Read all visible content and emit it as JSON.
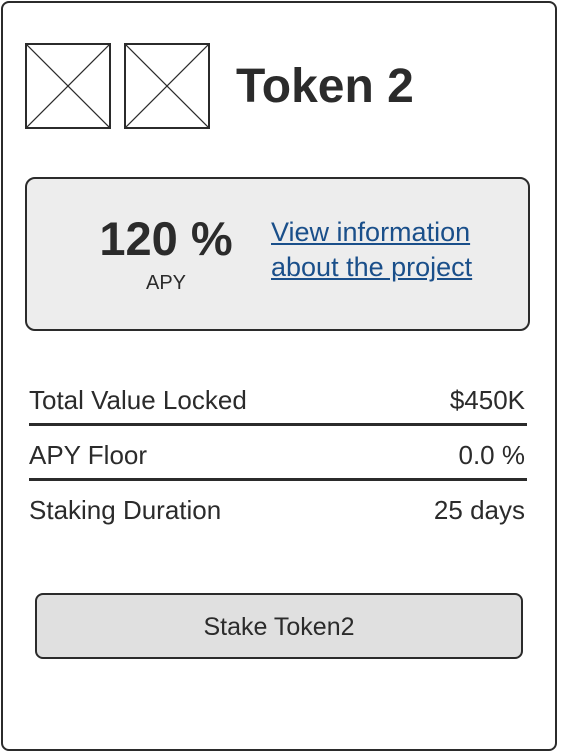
{
  "header": {
    "title": "Token 2",
    "icons": [
      "image-placeholder-icon",
      "image-placeholder-icon"
    ]
  },
  "apy_panel": {
    "value": "120 %",
    "label": "APY",
    "link_text": "View information about the project"
  },
  "stats": [
    {
      "label": "Total Value Locked",
      "value": "$450K"
    },
    {
      "label": "APY Floor",
      "value": "0.0 %"
    },
    {
      "label": "Staking Duration",
      "value": "25 days"
    }
  ],
  "actions": {
    "stake_label": "Stake Token2"
  },
  "colors": {
    "border": "#2b2b2b",
    "panel_background": "#ededed",
    "button_background": "#e0e0e0",
    "link": "#1a4f8a"
  }
}
